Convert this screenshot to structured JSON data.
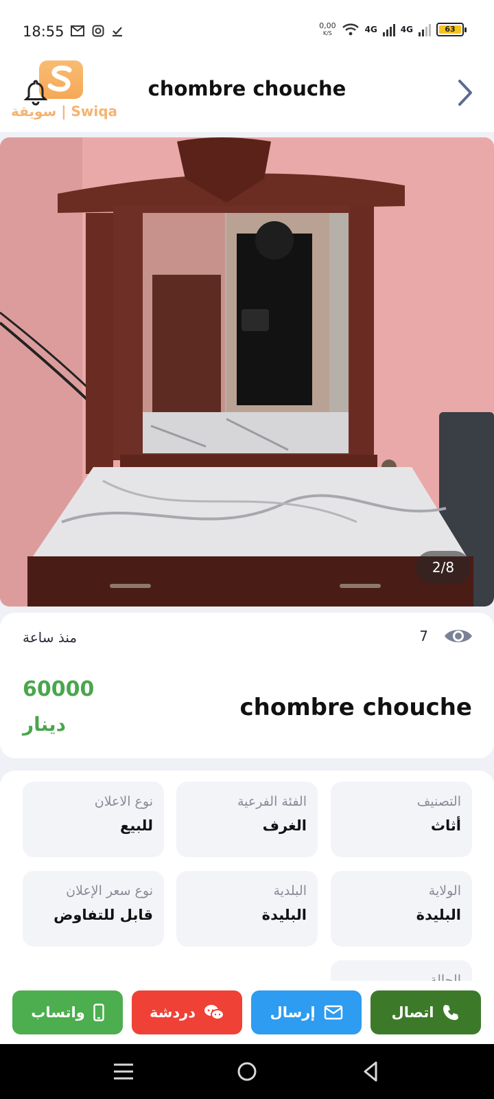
{
  "status_bar": {
    "time": "18:55",
    "net_speed_value": "0,00",
    "net_speed_unit": "K/S",
    "signal_1": "4G",
    "signal_2": "4G",
    "battery": "63"
  },
  "header": {
    "logo_text": "سويقة | Swiqa",
    "title": "chombre chouche"
  },
  "gallery": {
    "counter": "2/8"
  },
  "info": {
    "posted": "منذ ساعة",
    "views": "7",
    "price": "60000",
    "currency": "دينار",
    "title": "chombre chouche"
  },
  "details": [
    {
      "label": "التصنيف",
      "value": "أثاث"
    },
    {
      "label": "الفئة الفرعية",
      "value": "الغرف"
    },
    {
      "label": "نوع الاعلان",
      "value": "للبيع"
    },
    {
      "label": "الولاية",
      "value": "البليدة"
    },
    {
      "label": "البلدية",
      "value": "البليدة"
    },
    {
      "label": "نوع سعر الإعلان",
      "value": "قابل للتفاوض"
    },
    {
      "label": "الحالة",
      "value": ""
    }
  ],
  "actions": {
    "call": "اتصال",
    "send": "إرسال",
    "chat": "دردشة",
    "whatsapp": "واتساب"
  },
  "colors": {
    "price": "#4aa64c",
    "call": "#3c7a2a",
    "send": "#2d9cf1",
    "chat": "#ef4136",
    "whatsapp": "#4cae4f"
  }
}
